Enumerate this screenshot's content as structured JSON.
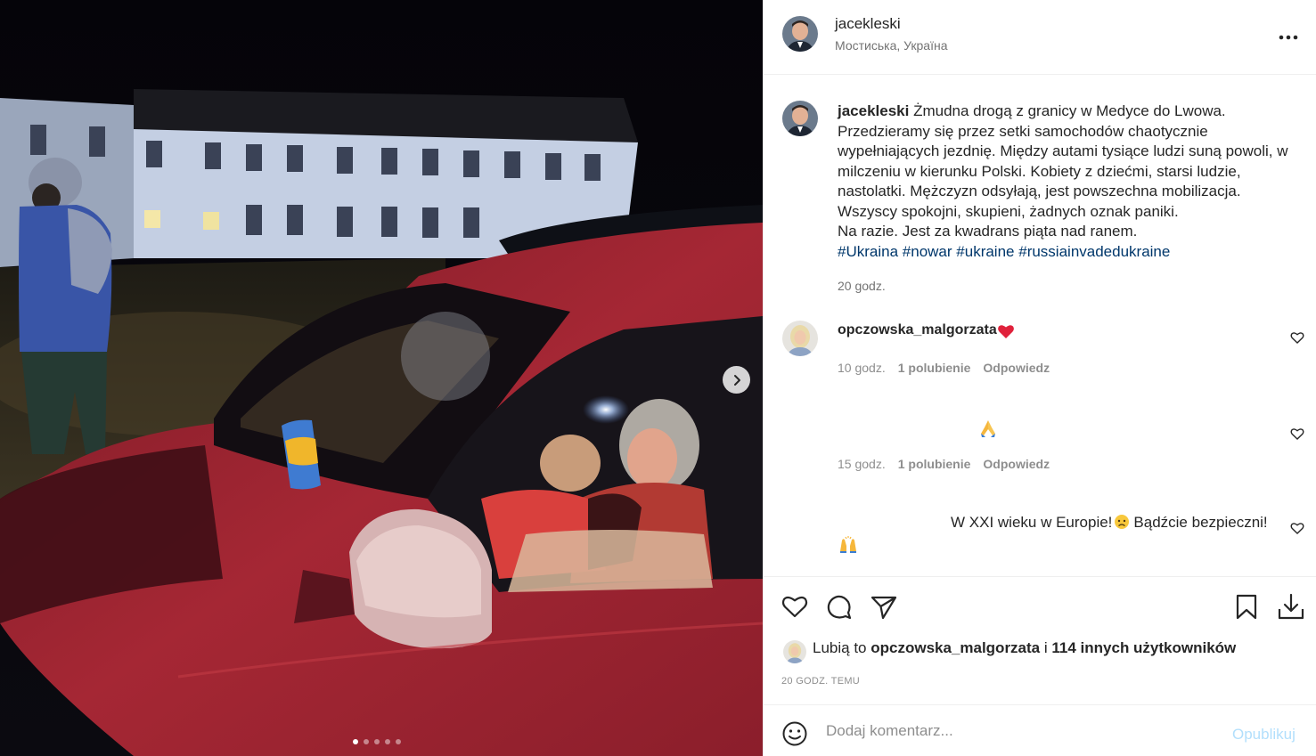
{
  "media": {
    "slide_count": 5,
    "active_slide": 1,
    "next_icon": "chevron-right-icon"
  },
  "header": {
    "username": "jacekleski",
    "location": "Мостиська, Україна",
    "more_icon": "more-horizontal-icon"
  },
  "caption": {
    "username": "jacekleski",
    "text_lines": [
      "Żmudna drogą z granicy w Medyce do Lwowa.",
      "Przedzieramy się przez setki samochodów chaotycznie",
      "wypełniających jezdnię. Między autami tysiące ludzi suną powoli, w",
      "milczeniu w kierunku Polski. Kobiety z dziećmi, starsi ludzie,",
      "nastolatki. Mężczyzn odsyłają, jest powszechna mobilizacja.",
      "Wszyscy spokojni, skupieni, żadnych oznak paniki.",
      "Na razie. Jest za kwadrans piąta nad ranem."
    ],
    "hashtags": [
      "#Ukraina",
      "#nowar",
      "#ukraine",
      "#russiainvadedukraine"
    ],
    "time": "20 godz."
  },
  "comments": [
    {
      "username": "opczowska_malgorzata",
      "emoji": "red-heart",
      "time": "10 godz.",
      "likes": "1 polubienie",
      "reply": "Odpowiedz"
    },
    {
      "emoji": "folded-hands",
      "time": "15 godz.",
      "likes": "1 polubienie",
      "reply": "Odpowiedz"
    },
    {
      "text": "W XXI wieku w Europie!",
      "text2": "Bądźcie bezpieczni!",
      "emoji": "worried-face",
      "emoji2": "raised-hands"
    }
  ],
  "actions": {
    "like_icon": "heart-icon",
    "comment_icon": "comment-icon",
    "share_icon": "send-icon",
    "save_icon": "bookmark-icon",
    "download_icon": "download-icon"
  },
  "likes": {
    "prefix": "Lubią to",
    "user": "opczowska_malgorzata",
    "conj": "i",
    "others": "114 innych użytkowników"
  },
  "post_date": "20 GODZ. TEMU",
  "comment_box": {
    "placeholder": "Dodaj komentarz...",
    "publish_label": "Opublikuj",
    "emoji_icon": "smiley-icon"
  },
  "colors": {
    "link": "#00376b",
    "muted": "#737373",
    "publish_disabled": "#b2dffc",
    "heart_red": "#ed4956"
  }
}
